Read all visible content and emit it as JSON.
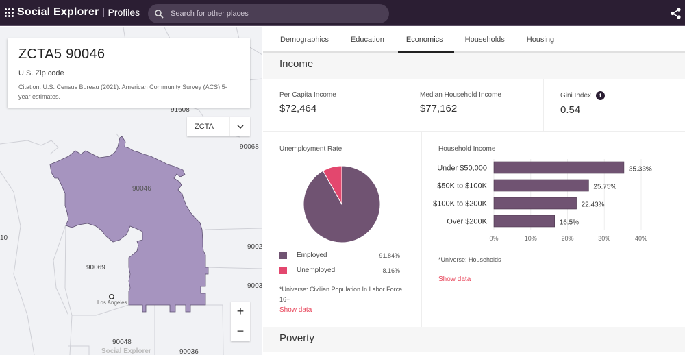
{
  "header": {
    "brand": "Social Explorer",
    "product": "Profiles",
    "search_placeholder": "Search for other places",
    "icons": {
      "search": "search-icon",
      "share": "share-icon"
    }
  },
  "place": {
    "title": "ZCTA5 90046",
    "type": "U.S. Zip code",
    "citation": "Citation: U.S. Census Bureau (2021). American Community Survey (ACS) 5-year estimates."
  },
  "map": {
    "geography_select": "ZCTA",
    "labels": [
      "91608",
      "90068",
      "90046",
      "10",
      "90069",
      "9002",
      "9003",
      "Los Angeles",
      "90048",
      "90036"
    ],
    "zoom_in": "+",
    "zoom_out": "−",
    "watermark": "Social Explorer",
    "highlight_color": "#a694bf"
  },
  "tabs": [
    {
      "label": "Demographics",
      "active": false
    },
    {
      "label": "Education",
      "active": false
    },
    {
      "label": "Economics",
      "active": true
    },
    {
      "label": "Households",
      "active": false
    },
    {
      "label": "Housing",
      "active": false
    }
  ],
  "income": {
    "heading": "Income",
    "stats": [
      {
        "label": "Per Capita Income",
        "value": "$72,464"
      },
      {
        "label": "Median Household Income",
        "value": "$77,162"
      },
      {
        "label": "Gini Index",
        "value": "0.54",
        "info": true
      }
    ]
  },
  "unemployment": {
    "title": "Unemployment Rate",
    "universe": "*Universe: Civilian Population In Labor Force 16+",
    "show_data": "Show data"
  },
  "household_income": {
    "title": "Household Income",
    "universe": "*Universe: Households",
    "show_data": "Show data"
  },
  "poverty": {
    "heading": "Poverty"
  },
  "colors": {
    "primary": "#705372",
    "accent": "#e3476e",
    "link": "#e8455a",
    "topbar": "#2b1e33"
  },
  "chart_data": [
    {
      "type": "pie",
      "title": "Unemployment Rate",
      "categories": [
        "Employed",
        "Unemployed"
      ],
      "values": [
        91.84,
        8.16
      ],
      "labels": [
        "91.84%",
        "8.16%"
      ],
      "colors": [
        "#705372",
        "#e3476e"
      ],
      "legend": "bottom"
    },
    {
      "type": "bar",
      "orientation": "horizontal",
      "title": "Household Income",
      "categories": [
        "Under $50,000",
        "$50K to $100K",
        "$100K to $200K",
        "Over $200K"
      ],
      "values": [
        35.33,
        25.75,
        22.43,
        16.5
      ],
      "labels": [
        "35.33%",
        "25.75%",
        "22.43%",
        "16.5%"
      ],
      "xticks": [
        "0%",
        "10%",
        "20%",
        "30%",
        "40%"
      ],
      "xlim": [
        0,
        40
      ],
      "grid": true,
      "color": "#705372"
    }
  ]
}
